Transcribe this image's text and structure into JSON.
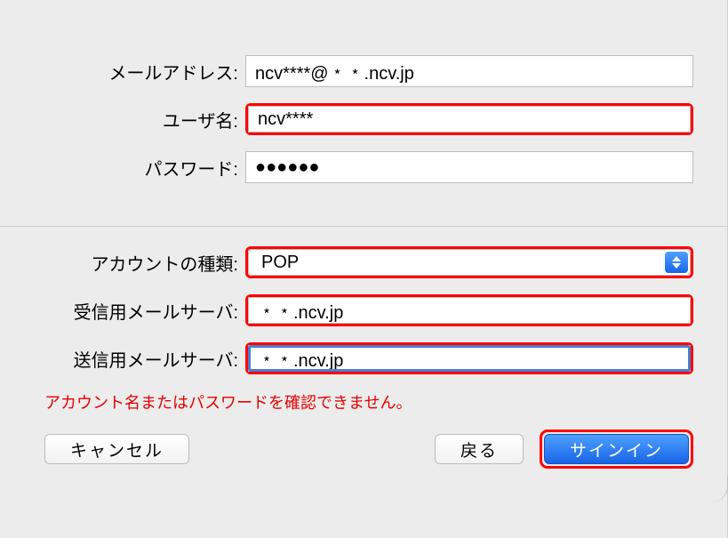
{
  "top": {
    "email": {
      "label": "メールアドレス:",
      "value": "ncv****@﹡﹡.ncv.jp"
    },
    "username": {
      "label": "ユーザ名:",
      "value": "ncv****"
    },
    "password": {
      "label": "パスワード:",
      "value": "●●●●●●"
    }
  },
  "bottom": {
    "account_type": {
      "label": "アカウントの種類:",
      "value": "POP"
    },
    "incoming_server": {
      "label": "受信用メールサーバ:",
      "value": "﹡﹡.ncv.jp"
    },
    "outgoing_server": {
      "label": "送信用メールサーバ:",
      "value": "﹡﹡.ncv.jp"
    }
  },
  "error": "アカウント名またはパスワードを確認できません。",
  "buttons": {
    "cancel": "キャンセル",
    "back": "戻る",
    "signin": "サインイン"
  }
}
